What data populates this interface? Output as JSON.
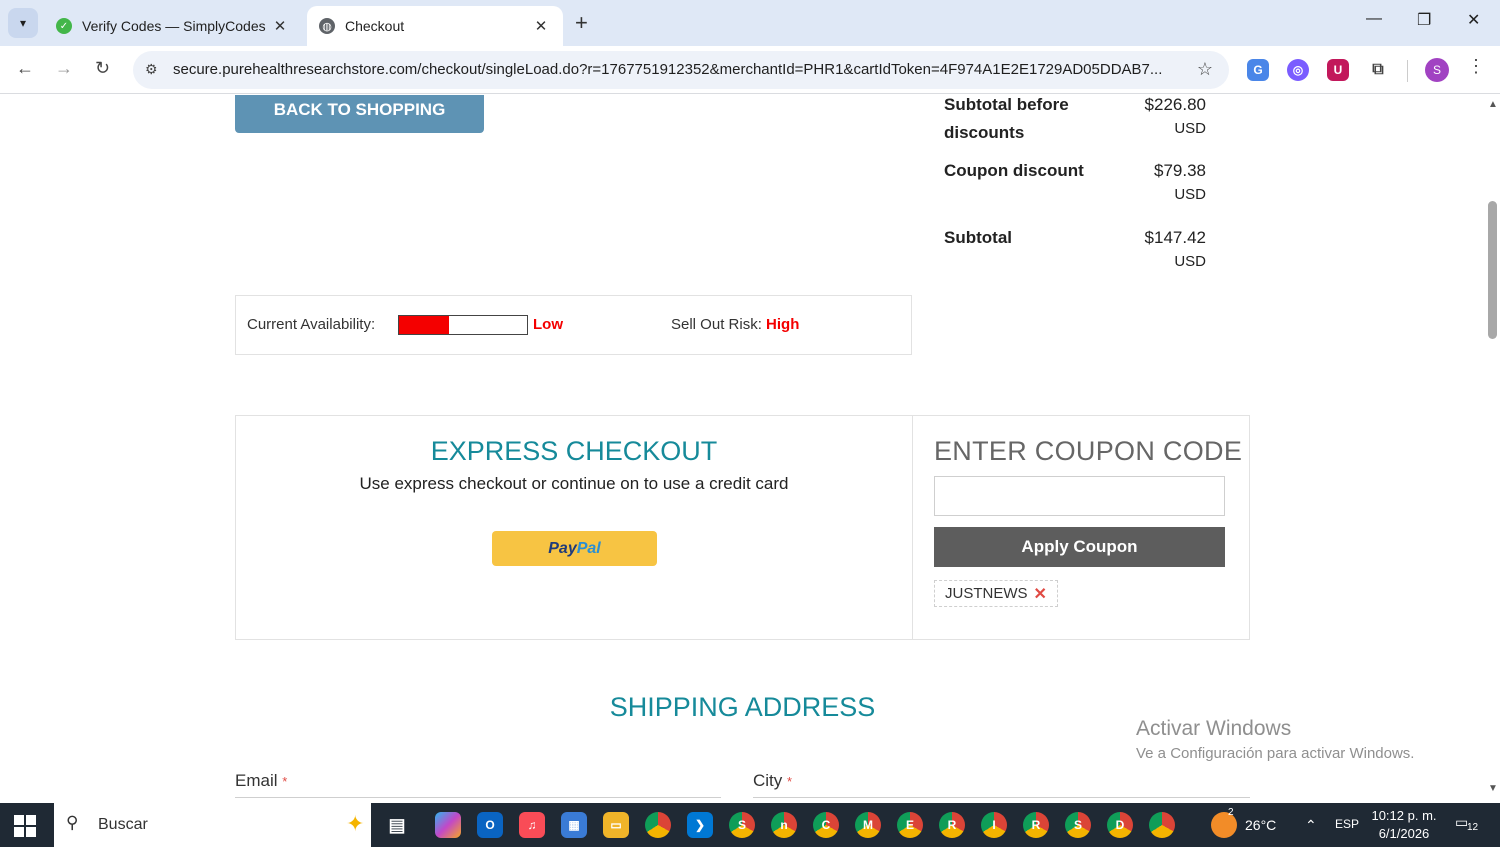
{
  "browser": {
    "tabs": [
      {
        "title": "Verify Codes — SimplyCodes"
      },
      {
        "title": "Checkout"
      }
    ],
    "url": "secure.purehealthresearchstore.com/checkout/singleLoad.do?r=1767751912352&merchantId=PHR1&cartIdToken=4F974A1E2E1729AD05DDAB7...",
    "profile_initial": "S"
  },
  "page": {
    "back_button": "BACK TO SHOPPING",
    "totals": [
      {
        "label": "Subtotal before discounts",
        "amount": "$226.80",
        "currency": "USD"
      },
      {
        "label": "Coupon discount",
        "amount": "$79.38",
        "currency": "USD"
      },
      {
        "label": "Subtotal",
        "amount": "$147.42",
        "currency": "USD"
      }
    ],
    "availability": {
      "label": "Current Availability:",
      "level": "Low",
      "level_fraction": 0.39,
      "risk_label": "Sell Out Risk:",
      "risk_value": "High",
      "bar_color": "#f40000"
    },
    "express": {
      "title": "EXPRESS CHECKOUT",
      "subtitle": "Use express checkout or continue on to use a credit card",
      "paypal_part1": "Pay",
      "paypal_part2": "Pal"
    },
    "coupon": {
      "title": "ENTER COUPON CODE",
      "input_value": "",
      "apply_label": "Apply Coupon",
      "applied_code": "JUSTNEWS",
      "remove_icon": "✕"
    },
    "shipping": {
      "title": "SHIPPING ADDRESS",
      "fields": [
        {
          "label": "Email",
          "required": "*"
        },
        {
          "label": "City",
          "required": "*"
        }
      ]
    },
    "watermark": {
      "line1": "Activar Windows",
      "line2": "Ve a Configuración para activar Windows."
    },
    "accent_color": "#168a9a"
  },
  "taskbar": {
    "search_placeholder": "Buscar",
    "weather": "26°C",
    "weather_badge": "2",
    "language": "ESP",
    "time": "10:12 p. m.",
    "date": "6/1/2026",
    "notifications": "12",
    "chrome_profiles": [
      "S",
      "n",
      "C",
      "M",
      "E",
      "R",
      "I",
      "R",
      "S",
      "D",
      ""
    ]
  }
}
